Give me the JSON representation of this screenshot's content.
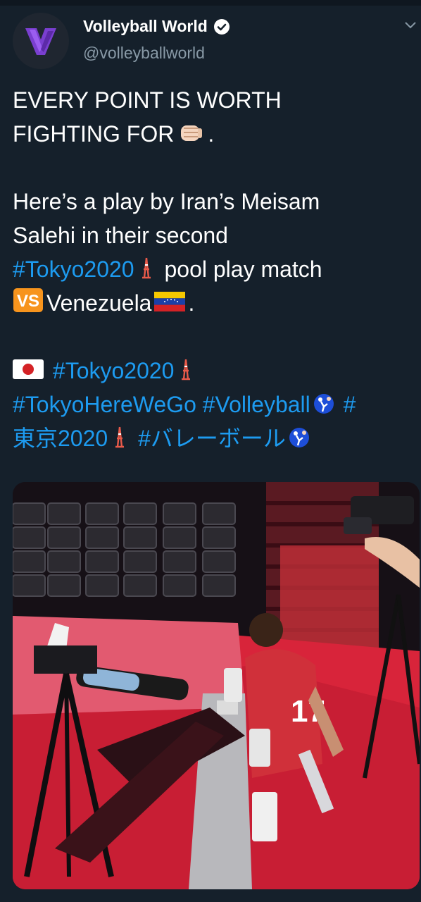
{
  "author": {
    "display_name": "Volleyball World",
    "handle": "@volleyballworld",
    "verified": true,
    "avatar_icon": "volleyball-world-logo-icon"
  },
  "tweet": {
    "line1": "EVERY POINT IS WORTH",
    "line2_text": "FIGHTING FOR",
    "line2_emoji": "fist-bump-icon",
    "line2_end": ".",
    "line3": "Here’s a play by Iran’s Meisam",
    "line4": "Salehi in their second",
    "hashtag_tokyo": "#Tokyo2020",
    "line5_rest": "pool play match",
    "vs_badge": "VS",
    "line6_text": "Venezuela",
    "line6_end": ".",
    "hashtag_tokyo_2": "#Tokyo2020",
    "hashtag_here": "#TokyoHereWeGo",
    "hashtag_volleyball": "#Volleyball",
    "hashtag_hash": "#",
    "hashtag_tokyo_jp": "東京2020",
    "hashtag_volley_jp": "#バレーボール"
  },
  "icons": {
    "tower": "tokyo-tower-icon",
    "flag_venezuela": "venezuela-flag-icon",
    "flag_japan": "japan-flag-icon",
    "volleyball_player": "volleyball-player-icon",
    "chevron": "chevron-down-icon"
  },
  "colors": {
    "background": "#15202b",
    "hashtag": "#1d9bf0",
    "handle": "#8899a6",
    "vs_badge": "#f7941d"
  }
}
